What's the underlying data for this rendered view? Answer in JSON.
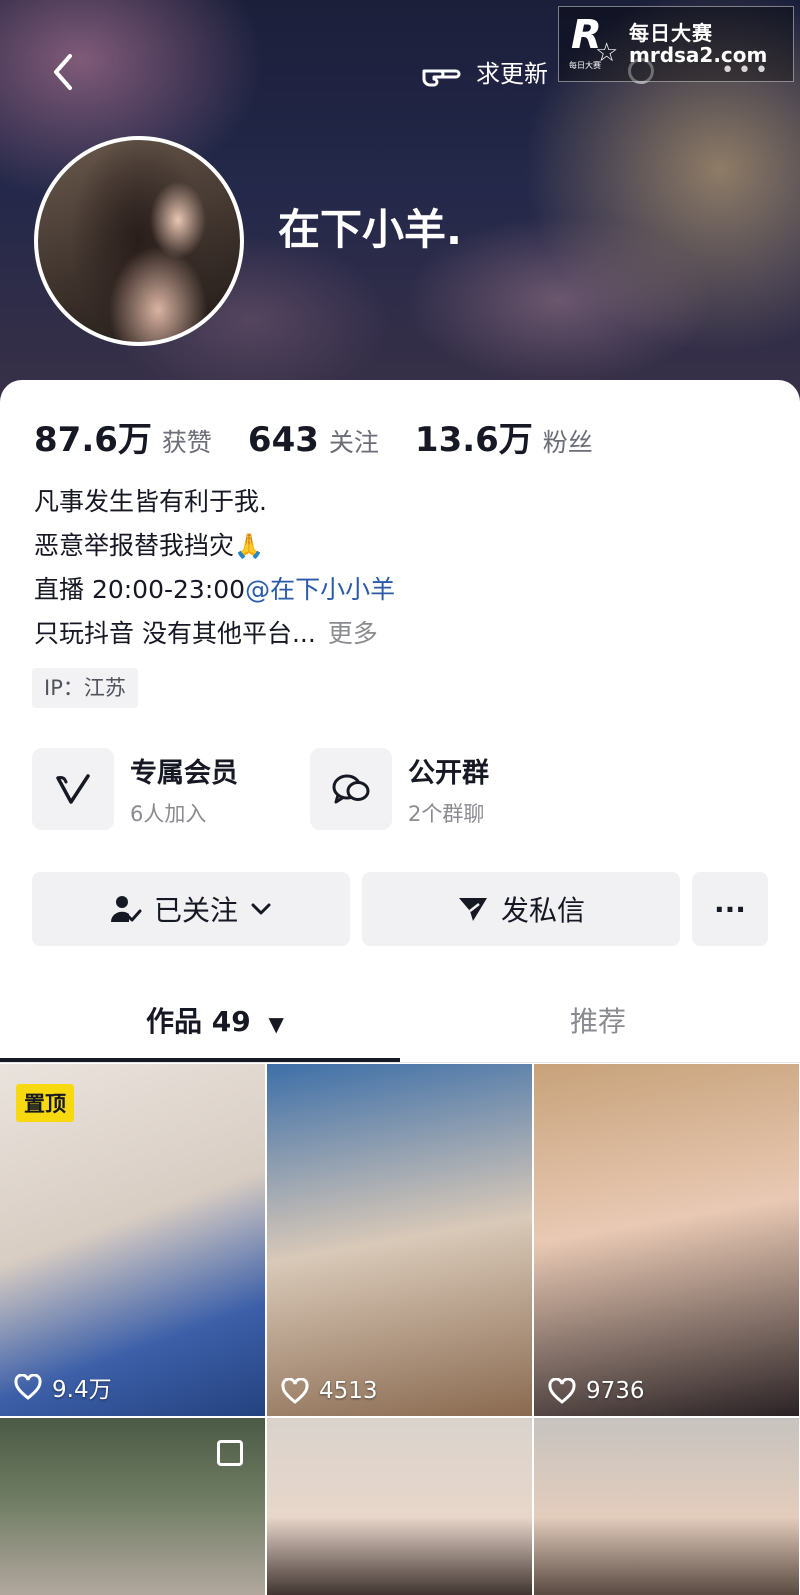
{
  "header": {
    "topbar_hint": "求更新",
    "nickname": "在下小羊.",
    "watermark": {
      "brand_cn": "每日大赛",
      "url": "mrdsa2.com",
      "logo_small": "每日大赛",
      "logo_letter": "R"
    }
  },
  "stats": [
    {
      "value": "87.6万",
      "label": "获赞"
    },
    {
      "value": "643",
      "label": "关注"
    },
    {
      "value": "13.6万",
      "label": "粉丝"
    }
  ],
  "bio": {
    "line1": "凡事发生皆有利于我.",
    "line2": "恶意举报替我挡灾",
    "line2_emoji": "🙏",
    "line3_prefix": "直播 20:00-23:00",
    "line3_link": "@在下小小羊",
    "line4": "只玩抖音 没有其他平台...",
    "more": "更多"
  },
  "ip_tag": "IP：江苏",
  "features": [
    {
      "title": "专属会员",
      "subtitle": "6人加入",
      "icon": "v-member-icon"
    },
    {
      "title": "公开群",
      "subtitle": "2个群聊",
      "icon": "group-chat-icon"
    }
  ],
  "actions": {
    "follow_label": "已关注",
    "message_label": "发私信",
    "more_label": "···"
  },
  "tabs": {
    "works_label": "作品 49",
    "works_arrow": "▼",
    "recommend_label": "推荐"
  },
  "videos": [
    {
      "likes": "9.4万",
      "pinned_label": "置顶"
    },
    {
      "likes": "4513"
    },
    {
      "likes": "9736"
    },
    {
      "likes": ""
    },
    {
      "likes": ""
    },
    {
      "likes": ""
    }
  ],
  "colors": {
    "accent_link": "#2a5aa8",
    "pin_badge": "#f8d90f",
    "button_bg": "#f1f1f3"
  }
}
